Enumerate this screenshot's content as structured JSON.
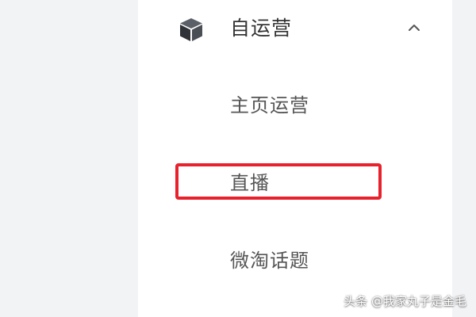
{
  "nav": {
    "group": {
      "icon": "box-icon",
      "title": "自运营",
      "expanded": true,
      "toggle_icon": "chevron-up-icon"
    },
    "items": [
      {
        "label": "主页运营"
      },
      {
        "label": "直播",
        "highlighted": true
      },
      {
        "label": "微淘话题"
      }
    ]
  },
  "watermark": "头条 @我家丸子是金毛",
  "colors": {
    "highlight_border": "#e8222c",
    "panel_background": "#ffffff",
    "page_background": "#f2f3f5",
    "text_primary": "#333333",
    "text_secondary": "#555555"
  }
}
